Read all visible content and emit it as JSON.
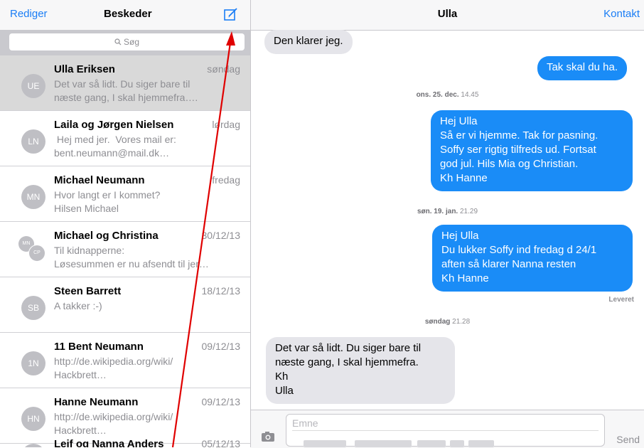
{
  "left_nav": {
    "edit": "Rediger",
    "title": "Beskeder",
    "compose_icon": "compose-icon"
  },
  "search": {
    "placeholder": "Søg",
    "icon": "search-icon"
  },
  "conversations": [
    {
      "initials": "UE",
      "name": "Ulla Eriksen",
      "date": "søndag",
      "preview": [
        "Det var så lidt. Du siger bare til",
        "næste gang, I skal hjemmefra…."
      ],
      "selected": true
    },
    {
      "initials": "LN",
      "name": "Laila og Jørgen Nielsen",
      "date": "lørdag",
      "preview": [
        " Hej med jer.  Vores mail er:",
        "bent.neumann@mail.dk…"
      ]
    },
    {
      "initials": "MN",
      "name": "Michael Neumann",
      "date": "fredag",
      "preview": [
        "Hvor langt er I kommet?",
        "Hilsen Michael"
      ]
    },
    {
      "initials": "MN",
      "initials2": "CP",
      "name": "Michael og Christina",
      "date": "30/12/13",
      "preview": [
        "Til kidnapperne:",
        "Løsesummen er nu afsendt til jer…"
      ]
    },
    {
      "initials": "SB",
      "name": "Steen Barrett",
      "date": "18/12/13",
      "preview": [
        "A takker :-)",
        ""
      ]
    },
    {
      "initials": "1N",
      "name": "11 Bent Neumann",
      "date": "09/12/13",
      "preview": [
        "http://de.wikipedia.org/wiki/",
        "Hackbrett…"
      ]
    },
    {
      "initials": "HN",
      "name": "Hanne Neumann",
      "date": "09/12/13",
      "preview": [
        "http://de.wikipedia.org/wiki/",
        "Hackbrett…"
      ]
    },
    {
      "initials": "",
      "name": "Leif og Nanna Anders",
      "date": "05/12/13",
      "preview": [
        "",
        ""
      ]
    }
  ],
  "right_nav": {
    "title": "Ulla",
    "contact": "Kontakt"
  },
  "messages": {
    "m1": "Den klarer jeg.",
    "m2": "Tak skal du ha.",
    "stamp1": {
      "day": "ons. 25. dec.",
      "time": "14.45"
    },
    "m3": [
      "Hej Ulla",
      "Så er vi hjemme. Tak for pasning.",
      "Soffy ser rigtig tilfreds ud. Fortsat",
      "god jul. Hils Mia og Christian.",
      "Kh Hanne"
    ],
    "stamp2": {
      "day": "søn. 19. jan.",
      "time": "21.29"
    },
    "m4": [
      "Hej Ulla",
      "Du lukker Soffy ind fredag d 24/1",
      "aften så klarer Nanna resten",
      "Kh Hanne"
    ],
    "delivered": "Leveret",
    "stamp3": {
      "day": "søndag",
      "time": "21.28"
    },
    "m5": [
      "Det var så lidt. Du siger bare til",
      "næste gang, I skal hjemmefra.",
      "Kh",
      "Ulla"
    ]
  },
  "compose": {
    "subject_placeholder": "Emne",
    "send": "Send",
    "camera_icon": "camera-icon"
  },
  "colors": {
    "accent": "#1a7df5",
    "out_bubble": "#1a8cf7",
    "in_bubble": "#e5e5ea",
    "annotation_arrow": "#e00000"
  }
}
